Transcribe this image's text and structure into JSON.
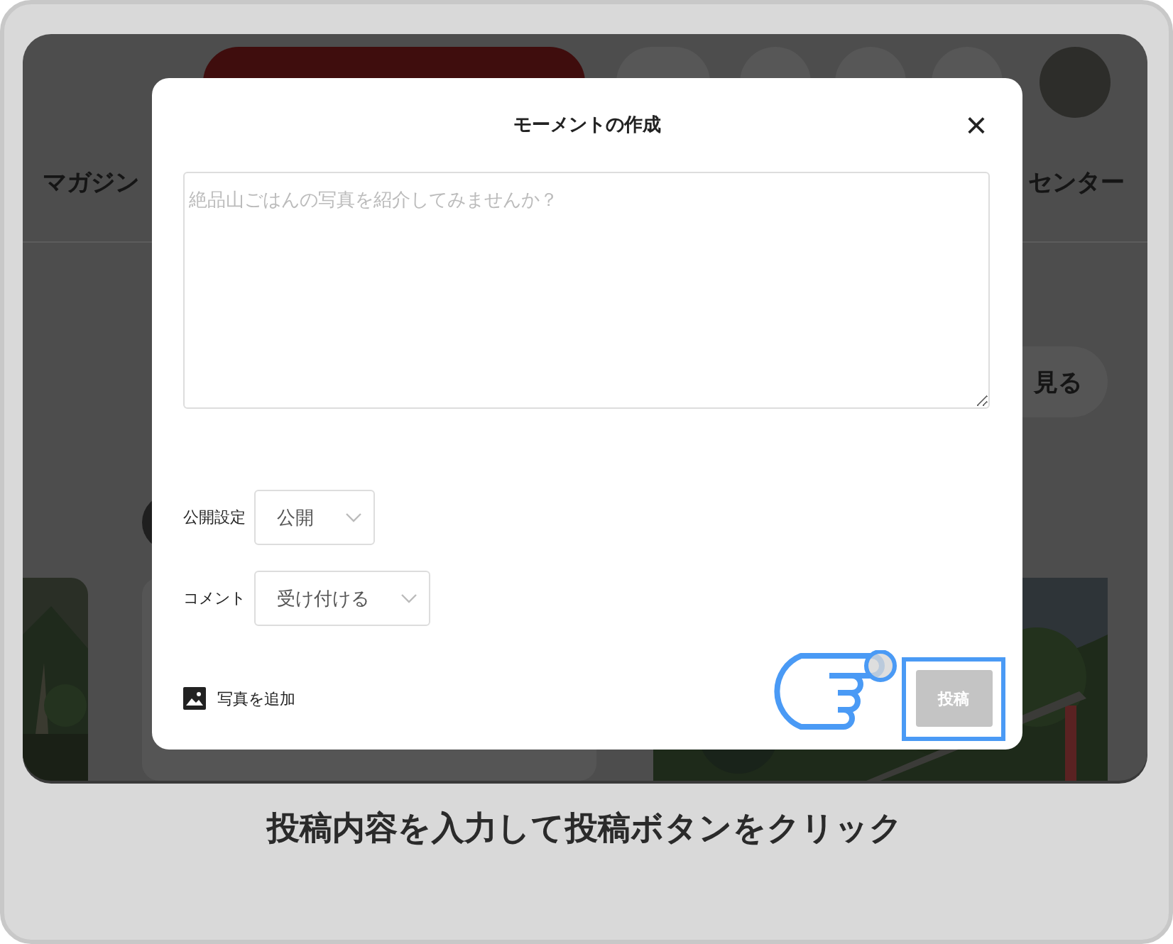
{
  "background": {
    "nav_left": "マガジン",
    "nav_right": "センター",
    "more_button": "見る"
  },
  "modal": {
    "title": "モーメントの作成",
    "close": "×",
    "textarea": {
      "placeholder": "絶品山ごはんの写真を紹介してみませんか？"
    },
    "settings": [
      {
        "label": "公開設定",
        "value": "公開"
      },
      {
        "label": "コメント",
        "value": "受け付ける"
      }
    ],
    "add_photo": "写真を追加",
    "post_button": {
      "label": "投稿",
      "disabled": true
    }
  },
  "caption": "投稿内容を入力して投稿ボタンをクリック"
}
